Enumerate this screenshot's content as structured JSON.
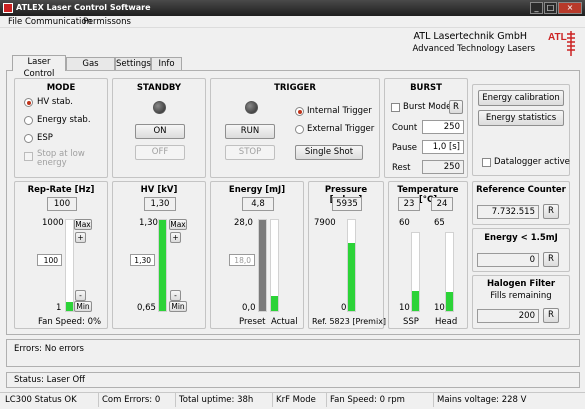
{
  "window": {
    "title": "ATLEX Laser Control Software",
    "minimize": "_",
    "maximize": "□",
    "close": "×"
  },
  "menu": [
    "File",
    "Communication",
    "Permissons"
  ],
  "company": {
    "name": "ATL Lasertechnik GmbH",
    "tagline": "Advanced Technology Lasers",
    "logo": "ATL"
  },
  "tabs": [
    "Laser Control",
    "Gas Control",
    "Settings",
    "Info"
  ],
  "mode": {
    "title": "MODE",
    "options": [
      "HV stab.",
      "Energy stab.",
      "ESP"
    ],
    "selected": 0,
    "stop_label": "Stop at low energy"
  },
  "standby": {
    "title": "STANDBY",
    "on": "ON",
    "off": "OFF"
  },
  "trigger": {
    "title": "TRIGGER",
    "run": "RUN",
    "stop": "STOP",
    "internal": "Internal Trigger",
    "external": "External Trigger",
    "single": "Single Shot"
  },
  "burst": {
    "title": "BURST",
    "mode_label": "Burst Mode",
    "r": "R",
    "count_label": "Count",
    "count": "250",
    "pause_label": "Pause",
    "pause": "1,0 [s]",
    "rest_label": "Rest",
    "rest": "250"
  },
  "side": {
    "energy_calibration": "Energy calibration",
    "energy_statistics": "Energy statistics",
    "datalogger": "Datalogger active"
  },
  "reprate": {
    "title": "Rep-Rate [Hz]",
    "value": "100",
    "max": "1000",
    "min": "1",
    "setpoint": "100",
    "max_btn": "Max",
    "plus": "+",
    "minus": "-",
    "min_btn": "Min",
    "fan": "Fan Speed: 0%",
    "level": 0.1
  },
  "hv": {
    "title": "HV [kV]",
    "value": "1,30",
    "max": "1,30",
    "min": "0,65",
    "setpoint": "1,30",
    "max_btn": "Max",
    "plus": "+",
    "minus": "-",
    "min_btn": "Min",
    "level": 1.0
  },
  "energy": {
    "title": "Energy [mJ]",
    "value": "4,8",
    "max": "28,0",
    "min": "0,0",
    "setpoint": "18,0",
    "preset_label": "Preset",
    "actual_label": "Actual",
    "preset_level": 1.0,
    "actual_level": 0.17
  },
  "pressure": {
    "title": "Pressure [mbar]",
    "value": "5935",
    "max": "7900",
    "min": "0",
    "ref": "Ref. 5823 [Premix]",
    "level": 0.75
  },
  "temperature": {
    "title": "Temperature [°C]",
    "ssp": "23",
    "head": "24",
    "ssp_max": "60",
    "head_max": "65",
    "ssp_min": "10",
    "head_min": "10",
    "ssp_label": "SSP",
    "head_label": "Head",
    "ssp_level": 0.26,
    "head_level": 0.25
  },
  "refcounter": {
    "title": "Reference Counter",
    "value": "7.732.515",
    "r": "R"
  },
  "lowenergy": {
    "title": "Energy < 1.5mJ",
    "value": "0",
    "r": "R"
  },
  "halogen": {
    "title": "Halogen Filter",
    "sub": "Fills remaining",
    "value": "200",
    "r": "R"
  },
  "errors": "Errors: No errors",
  "status": "Status: Laser Off",
  "statusbar": [
    "LC300 Status OK",
    "Com Errors: 0",
    "Total uptime: 38h",
    "KrF Mode",
    "Fan Speed: 0 rpm",
    "Mains voltage: 228 V"
  ],
  "colors": {
    "accent": "#2cd338",
    "radio": "#c0341a",
    "titlebar": "#2a2a2a"
  }
}
